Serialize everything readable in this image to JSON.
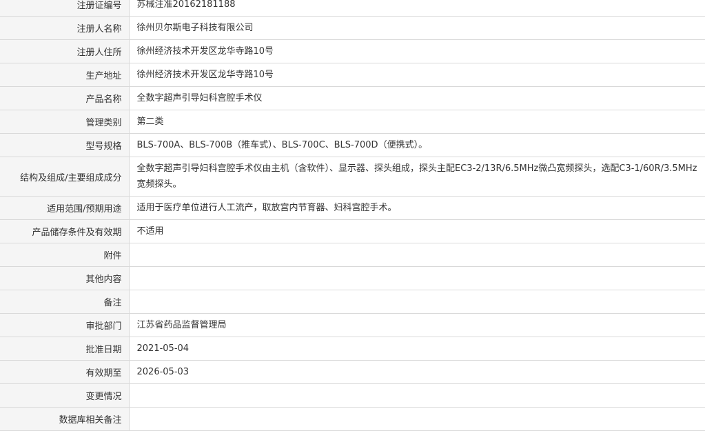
{
  "rows": [
    {
      "label": "注册证编号",
      "value": "苏械注准20162181188"
    },
    {
      "label": "注册人名称",
      "value": "徐州贝尔斯电子科技有限公司"
    },
    {
      "label": "注册人住所",
      "value": "徐州经济技术开发区龙华寺路10号"
    },
    {
      "label": "生产地址",
      "value": "徐州经济技术开发区龙华寺路10号"
    },
    {
      "label": "产品名称",
      "value": "全数字超声引导妇科宫腔手术仪"
    },
    {
      "label": "管理类别",
      "value": "第二类"
    },
    {
      "label": "型号规格",
      "value": "BLS-700A、BLS-700B（推车式）、BLS-700C、BLS-700D（便携式）。"
    },
    {
      "label": "结构及组成/主要组成成分",
      "value": "全数字超声引导妇科宫腔手术仪由主机（含软件）、显示器、探头组成，探头主配EC3-2/13R/6.5MHz微凸宽频探头，选配C3-1/60R/3.5MHz宽频探头。"
    },
    {
      "label": "适用范围/预期用途",
      "value": "适用于医疗单位进行人工流产，取放宫内节育器、妇科宫腔手术。"
    },
    {
      "label": "产品储存条件及有效期",
      "value": "不适用"
    },
    {
      "label": "附件",
      "value": ""
    },
    {
      "label": "其他内容",
      "value": ""
    },
    {
      "label": "备注",
      "value": ""
    },
    {
      "label": "审批部门",
      "value": "江苏省药品监督管理局"
    },
    {
      "label": "批准日期",
      "value": "2021-05-04"
    },
    {
      "label": "有效期至",
      "value": "2026-05-03"
    },
    {
      "label": "变更情况",
      "value": ""
    },
    {
      "label": "数据库相关备注",
      "value": ""
    }
  ]
}
